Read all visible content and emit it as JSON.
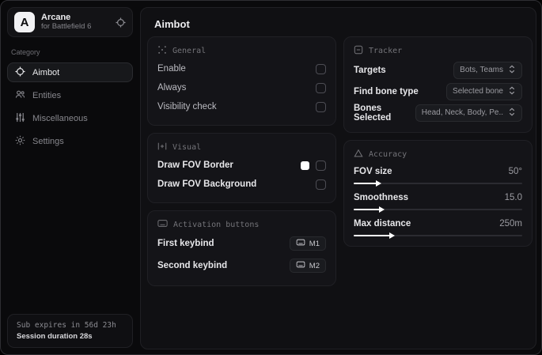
{
  "app": {
    "logo_letter": "A",
    "name": "Arcane",
    "subtitle": "for Battlefield 6"
  },
  "sidebar": {
    "category_label": "Category",
    "items": [
      {
        "label": "Aimbot"
      },
      {
        "label": "Entities"
      },
      {
        "label": "Miscellaneous"
      },
      {
        "label": "Settings"
      }
    ],
    "subscription": {
      "expiry": "Sub expires in 56d 23h",
      "session": "Session duration 28s"
    }
  },
  "main": {
    "title": "Aimbot",
    "general": {
      "title": "General",
      "rows": [
        {
          "label": "Enable",
          "checked": false
        },
        {
          "label": "Always",
          "checked": false
        },
        {
          "label": "Visibility check",
          "checked": false
        }
      ]
    },
    "visual": {
      "title": "Visual",
      "rows": [
        {
          "label": "Draw FOV Border",
          "swatch": "#ffffff",
          "checked": false
        },
        {
          "label": "Draw FOV Background",
          "checked": false
        }
      ]
    },
    "activation": {
      "title": "Activation buttons",
      "rows": [
        {
          "label": "First keybind",
          "key": "M1"
        },
        {
          "label": "Second keybind",
          "key": "M2"
        }
      ]
    },
    "tracker": {
      "title": "Tracker",
      "rows": [
        {
          "label": "Targets",
          "value": "Bots, Teams"
        },
        {
          "label": "Find bone type",
          "value": "Selected bone"
        },
        {
          "label": "Bones Selected",
          "value": "Head, Neck, Body, Pe.."
        }
      ]
    },
    "accuracy": {
      "title": "Accuracy",
      "sliders": [
        {
          "label": "FOV size",
          "value": "50°",
          "percent": 14
        },
        {
          "label": "Smoothness",
          "value": "15.0",
          "percent": 16
        },
        {
          "label": "Max distance",
          "value": "250m",
          "percent": 22
        }
      ]
    }
  },
  "colors": {
    "accent": "#ffffff",
    "fov_border_swatch": "#ffffff"
  }
}
